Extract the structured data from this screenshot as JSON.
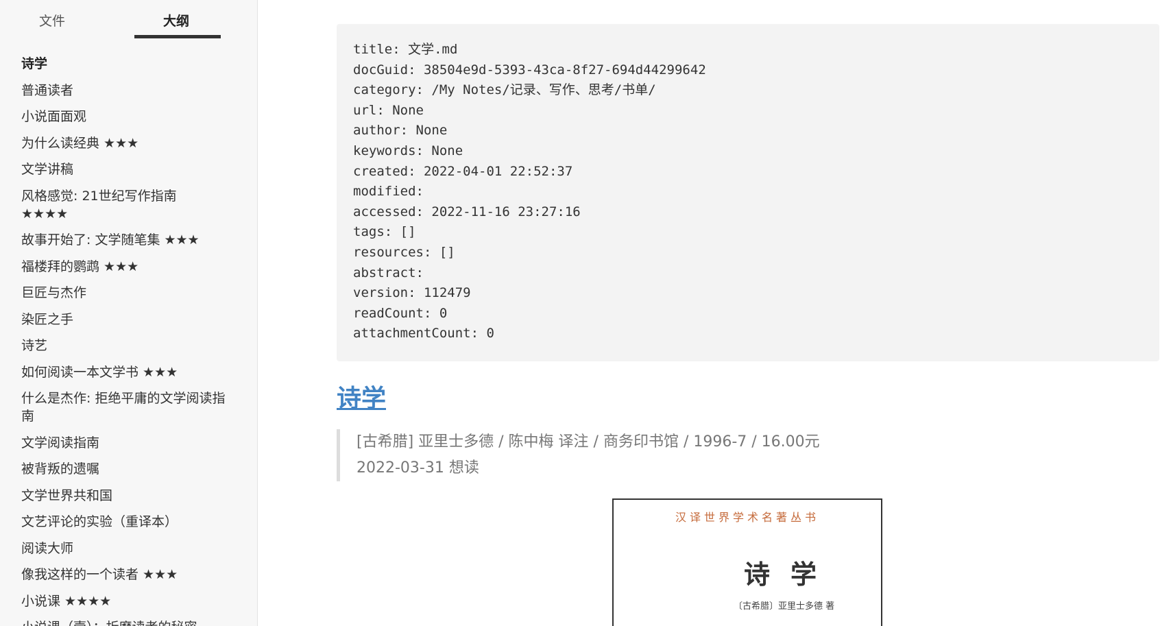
{
  "sidebar": {
    "tabs": {
      "files": "文件",
      "outline": "大纲"
    },
    "items": [
      "诗学",
      "普通读者",
      "小说面面观",
      "为什么读经典 ★★★",
      "文学讲稿",
      "风格感觉: 21世纪写作指南 ★★★★",
      "故事开始了: 文学随笔集 ★★★",
      "福楼拜的鹦鹉 ★★★",
      "巨匠与杰作",
      "染匠之手",
      "诗艺",
      "如何阅读一本文学书 ★★★",
      "什么是杰作: 拒绝平庸的文学阅读指南",
      "文学阅读指南",
      "被背叛的遗嘱",
      "文学世界共和国",
      "文艺评论的实验（重译本）",
      "阅读大师",
      "像我这样的一个读者 ★★★",
      "小说课 ★★★★",
      "小说课（壹）：折磨读者的秘密"
    ]
  },
  "frontmatter": [
    "title: 文学.md",
    "docGuid: 38504e9d-5393-43ca-8f27-694d44299642",
    "category: /My Notes/记录、写作、思考/书单/",
    "url: None",
    "author: None",
    "keywords: None",
    "created: 2022-04-01 22:52:37",
    "modified:",
    "accessed: 2022-11-16 23:27:16",
    "tags: []",
    "resources: []",
    "abstract:",
    "version: 112479",
    "readCount: 0",
    "attachmentCount: 0"
  ],
  "heading": "诗学",
  "quote": [
    "[古希腊] 亚里士多德 / 陈中梅 译注 / 商务印书馆 / 1996-7 / 16.00元",
    "2022-03-31 想读"
  ],
  "cover": {
    "series": "汉译世界学术名著丛书",
    "title": "诗学",
    "author": "〔古希腊〕亚里士多德 著"
  },
  "colors": {
    "link": "#4183c4",
    "sidebar_bg": "#f7f7f7",
    "code_bg": "#f3f3f3"
  }
}
